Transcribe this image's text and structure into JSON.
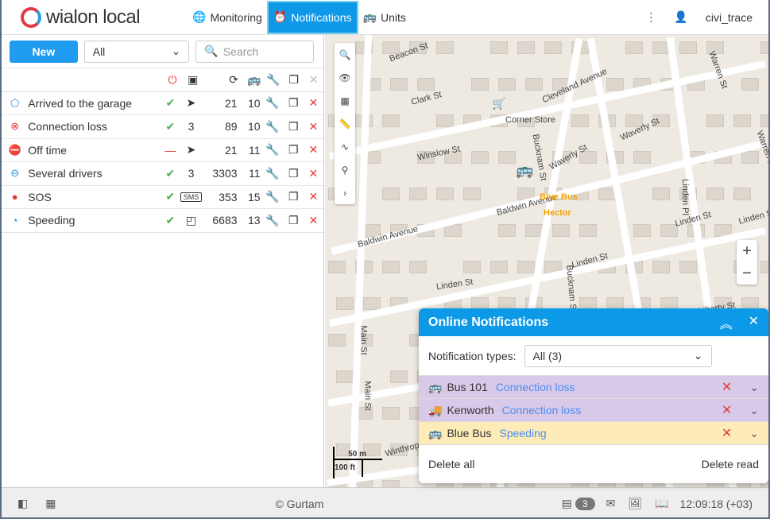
{
  "header": {
    "logo": "wialon local",
    "nav": [
      {
        "label": "Monitoring",
        "icon": "globe-icon"
      },
      {
        "label": "Notifications",
        "icon": "alarm-clock-icon",
        "active": true
      },
      {
        "label": "Units",
        "icon": "bus-icon"
      }
    ],
    "username": "civi_trace"
  },
  "left_panel": {
    "new_label": "New",
    "filter_value": "All",
    "search_placeholder": "Search",
    "rows": [
      {
        "name": "Arrived to the garage",
        "icon": "geofence-icon",
        "enabled": true,
        "action": "telegram",
        "triggered": "21",
        "units": "10"
      },
      {
        "name": "Connection loss",
        "icon": "connection-loss-icon",
        "enabled": true,
        "action": "3",
        "triggered": "89",
        "units": "10"
      },
      {
        "name": "Off time",
        "icon": "stop-icon",
        "enabled": false,
        "action": "telegram",
        "triggered": "21",
        "units": "11"
      },
      {
        "name": "Several drivers",
        "icon": "steering-wheel-icon",
        "enabled": true,
        "action": "3",
        "triggered": "3303",
        "units": "11"
      },
      {
        "name": "SOS",
        "icon": "sos-icon",
        "enabled": true,
        "action": "SMS",
        "triggered": "353",
        "units": "15"
      },
      {
        "name": "Speeding",
        "icon": "speedometer-icon",
        "enabled": true,
        "action": "window",
        "triggered": "6683",
        "units": "13"
      }
    ]
  },
  "map": {
    "labels": [
      "Beacon St",
      "Clark St",
      "Cleveland Avenue",
      "Corner Store",
      "Winslow St",
      "Waverly St",
      "Waverly St",
      "Warren St",
      "Warren St",
      "Bucknam St",
      "Baldwin Avenue",
      "Baldwin Avenue",
      "Blue Bus",
      "Hector",
      "Linden St",
      "Linden St",
      "Linden St",
      "Linden Pl",
      "Liberty St",
      "Main St",
      "Main St",
      "Winthrop St",
      "Bucknam St",
      "Linden St"
    ],
    "scale_m": "50 m",
    "scale_ft": "100 ft"
  },
  "online": {
    "title": "Online Notifications",
    "types_label": "Notification types:",
    "types_value": "All (3)",
    "items": [
      {
        "unit": "Bus 101",
        "type": "Connection loss",
        "bg": "#d9c9e9",
        "icon": "🚌"
      },
      {
        "unit": "Kenworth",
        "type": "Connection loss",
        "bg": "#d9c9e9",
        "icon": "🚚"
      },
      {
        "unit": "Blue Bus",
        "type": "Speeding",
        "bg": "#fdebb8",
        "icon": "🚌"
      }
    ],
    "delete_all": "Delete all",
    "delete_read": "Delete read"
  },
  "footer": {
    "copyright": "© Gurtam",
    "count": "3",
    "time": "12:09:18 (+03)"
  }
}
